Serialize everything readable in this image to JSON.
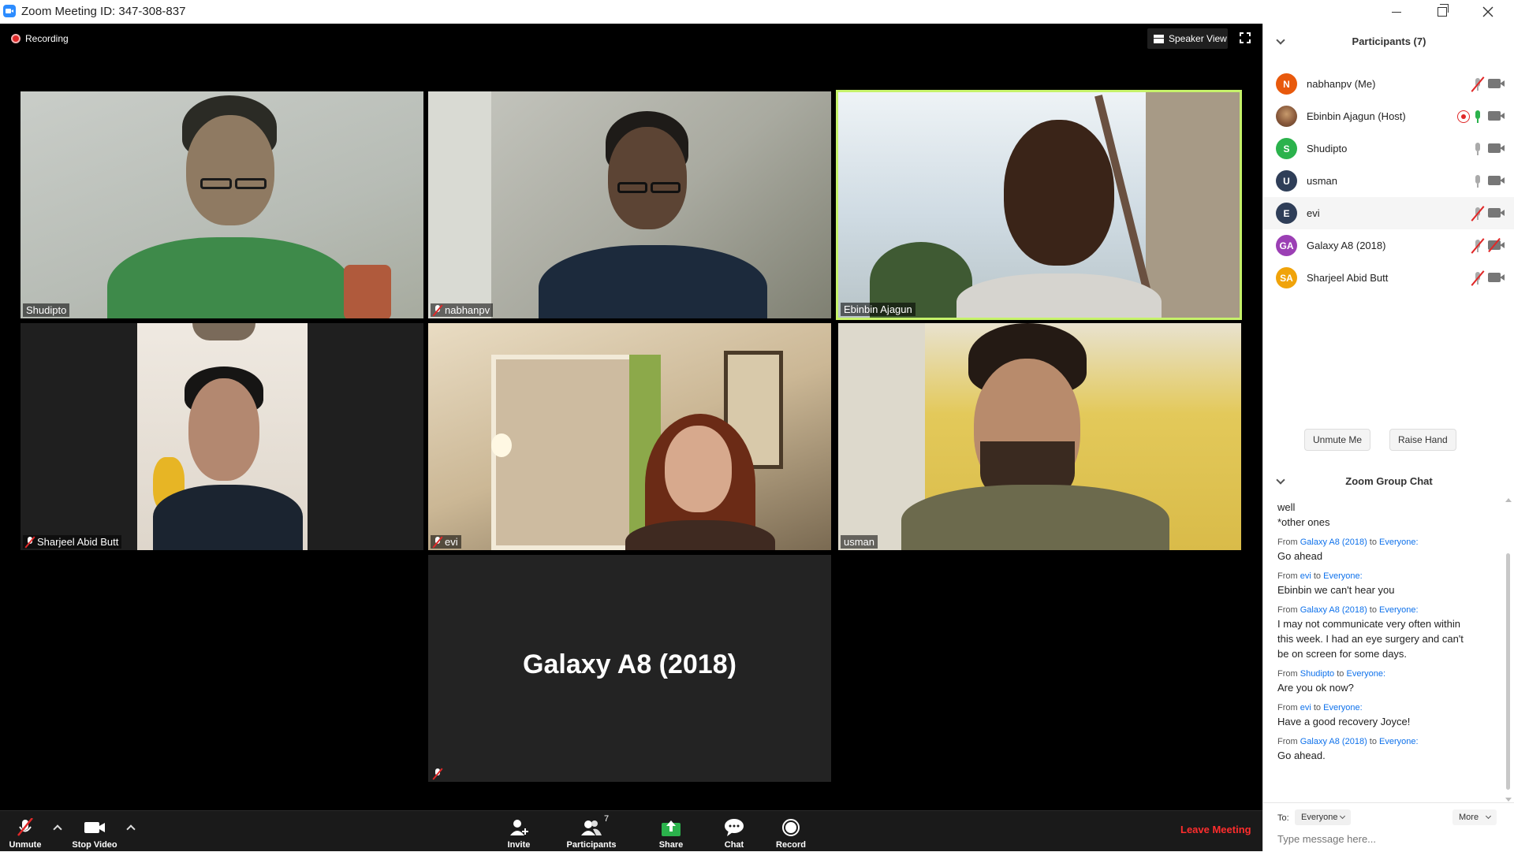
{
  "window": {
    "title": "Zoom Meeting ID: 347-308-837"
  },
  "meeting": {
    "recording_label": "Recording",
    "view_label": "Speaker View",
    "tiles": [
      {
        "name": "Shudipto",
        "muted": false
      },
      {
        "name": "nabhanpv",
        "muted": true
      },
      {
        "name": "Ebinbin Ajagun",
        "muted": false,
        "active_speaker": true
      },
      {
        "name": "Sharjeel Abid Butt",
        "muted": true
      },
      {
        "name": "evi",
        "muted": true
      },
      {
        "name": "usman",
        "muted": false
      },
      {
        "name": "Galaxy A8 (2018)",
        "muted": true,
        "video": false
      }
    ]
  },
  "toolbar": {
    "unmute": "Unmute",
    "stop_video": "Stop Video",
    "invite": "Invite",
    "participants": "Participants",
    "participants_count": "7",
    "share": "Share",
    "chat": "Chat",
    "record": "Record",
    "leave": "Leave Meeting"
  },
  "participants_panel": {
    "title": "Participants (7)",
    "items": [
      {
        "initials": "N",
        "name": "nabhanpv (Me)",
        "color": "#e8590c",
        "mic": "muted",
        "cam": "on"
      },
      {
        "initials": "",
        "name": "Ebinbin Ajagun (Host)",
        "color": "#8a5a3c",
        "mic": "on",
        "cam": "on",
        "recording": true
      },
      {
        "initials": "S",
        "name": "Shudipto",
        "color": "#2bb24c",
        "mic": "idle",
        "cam": "on"
      },
      {
        "initials": "U",
        "name": "usman",
        "color": "#2f3e58",
        "mic": "idle",
        "cam": "on"
      },
      {
        "initials": "E",
        "name": "evi",
        "color": "#2f3e58",
        "mic": "muted",
        "cam": "on"
      },
      {
        "initials": "GA",
        "name": "Galaxy A8 (2018)",
        "color": "#9b3fb4",
        "mic": "muted",
        "cam": "off"
      },
      {
        "initials": "SA",
        "name": "Sharjeel Abid Butt",
        "color": "#f0a30a",
        "mic": "muted",
        "cam": "on"
      }
    ],
    "unmute_me": "Unmute Me",
    "raise_hand": "Raise Hand"
  },
  "chat": {
    "title": "Zoom Group Chat",
    "lead_lines": [
      "well",
      "*other ones"
    ],
    "messages": [
      {
        "from": "Galaxy A8 (2018)",
        "to": "Everyone:",
        "text": "Go ahead"
      },
      {
        "from": "evi",
        "to": "Everyone:",
        "text": "Ebinbin we can't hear you"
      },
      {
        "from": "Galaxy A8 (2018)",
        "to": "Everyone:",
        "text": "I may not communicate very often within this week. I had an eye surgery and can't be on screen for some days."
      },
      {
        "from": "Shudipto",
        "to": "Everyone:",
        "text": "Are you ok now?"
      },
      {
        "from": "evi",
        "to": "Everyone:",
        "text": "Have a good recovery Joyce!"
      },
      {
        "from": "Galaxy A8 (2018)",
        "to": "Everyone:",
        "text": "Go ahead."
      }
    ],
    "from_word": "From",
    "to_word": "to",
    "to_label": "To:",
    "recipient": "Everyone",
    "more": "More",
    "placeholder": "Type message here..."
  }
}
